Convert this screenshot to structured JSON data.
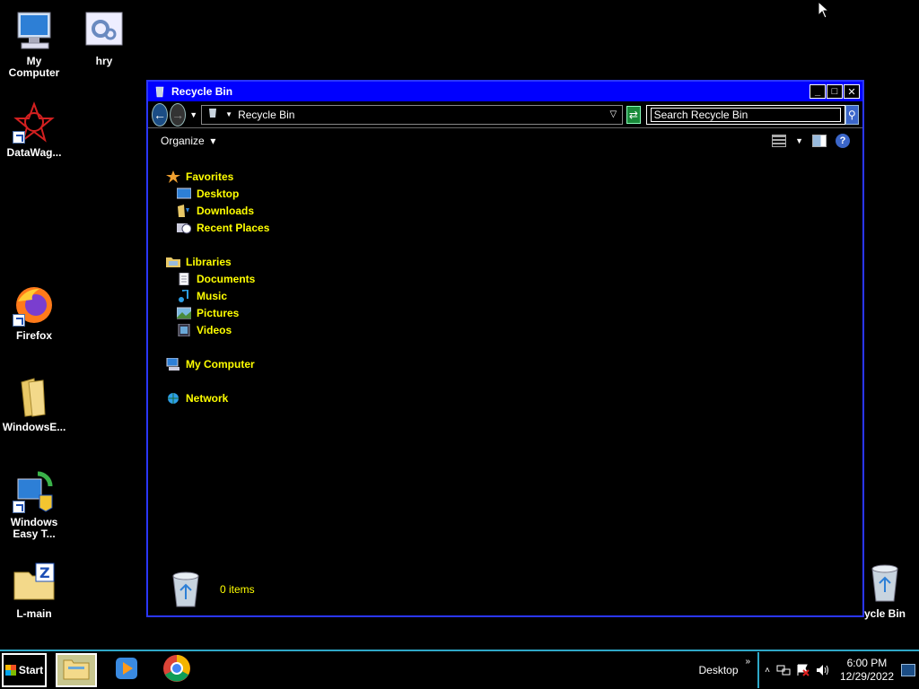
{
  "desktop": {
    "icons": [
      {
        "label": "My Computer"
      },
      {
        "label": "hry"
      },
      {
        "label": "DataWag..."
      },
      {
        "label": "Firefox"
      },
      {
        "label": "WindowsE..."
      },
      {
        "label": "Windows Easy T..."
      },
      {
        "label": "L-main"
      },
      {
        "label": "ycle Bin"
      }
    ]
  },
  "window": {
    "title": "Recycle Bin",
    "address": "Recycle Bin",
    "search_placeholder": "Search Recycle Bin",
    "organize_label": "Organize",
    "nav": {
      "favorites": {
        "label": "Favorites",
        "items": [
          "Desktop",
          "Downloads",
          "Recent Places"
        ]
      },
      "libraries": {
        "label": "Libraries",
        "items": [
          "Documents",
          "Music",
          "Pictures",
          "Videos"
        ]
      },
      "computer": "My Computer",
      "network": "Network"
    },
    "status": "0 items"
  },
  "taskbar": {
    "start_label": "Start",
    "desktop_label": "Desktop",
    "time": "6:00 PM",
    "date": "12/29/2022"
  },
  "colors": {
    "accent_blue": "#0000ff",
    "nav_text": "#ffff00",
    "taskbar_border": "#2fa8c8"
  }
}
